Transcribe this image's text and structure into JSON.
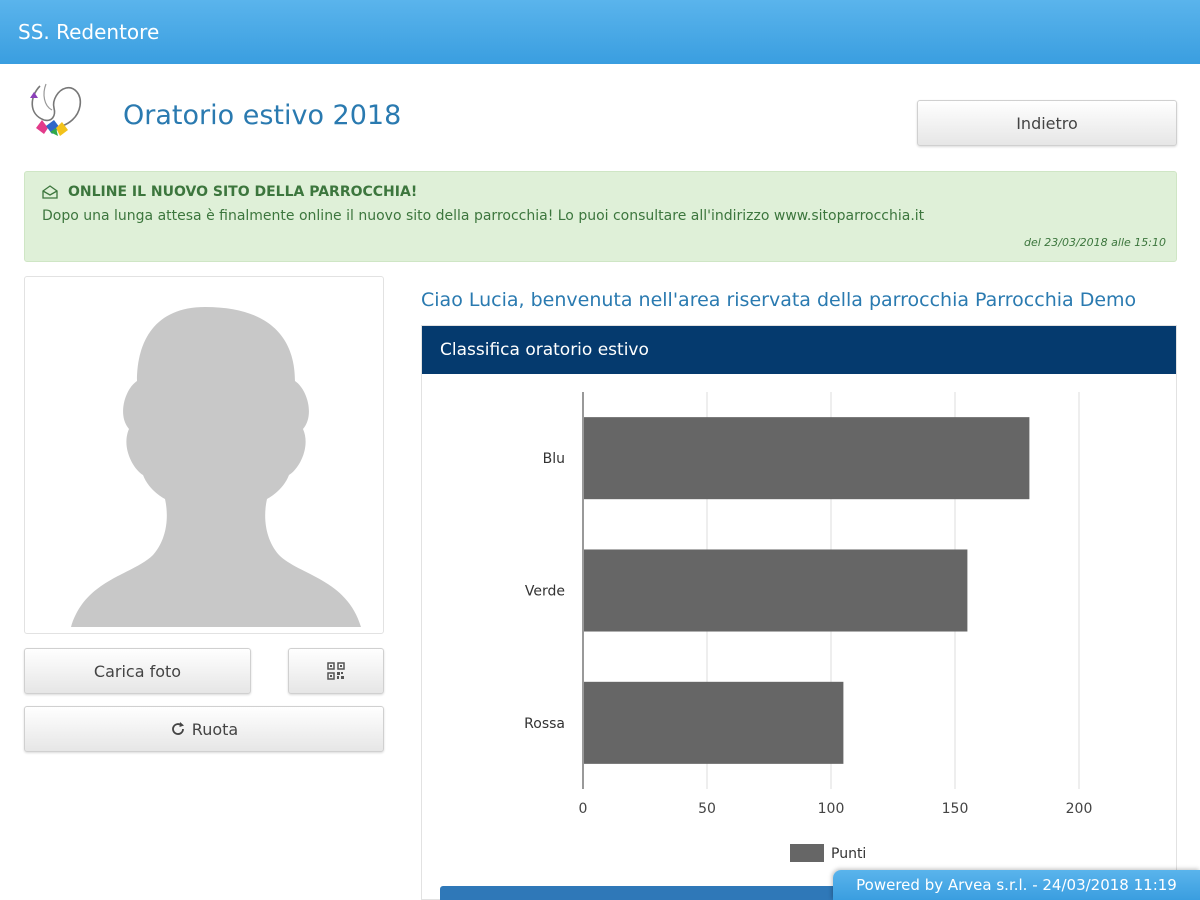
{
  "topbar": {
    "title": "SS. Redentore"
  },
  "header": {
    "page_title": "Oratorio estivo 2018",
    "back_label": "Indietro"
  },
  "alert": {
    "title": "ONLINE IL NUOVO SITO DELLA PARROCCHIA!",
    "body": "Dopo una lunga attesa è finalmente online il nuovo sito della parrocchia! Lo puoi consultare all'indirizzo www.sitoparrocchia.it",
    "date": "del 23/03/2018 alle 15:10"
  },
  "profile": {
    "upload_label": "Carica foto",
    "qr_icon": "qr-code-icon",
    "rotate_label": "Ruota"
  },
  "welcome": "Ciao Lucia, benvenuta nell'area riservata della parrocchia Parrocchia Demo",
  "panel": {
    "title": "Classifica oratorio estivo"
  },
  "chart_data": {
    "type": "bar",
    "orientation": "horizontal",
    "categories": [
      "Blu",
      "Verde",
      "Rossa"
    ],
    "series": [
      {
        "name": "Punti",
        "values": [
          180,
          155,
          105
        ],
        "color": "#666666"
      }
    ],
    "xlim": [
      0,
      200
    ],
    "xticks": [
      0,
      50,
      100,
      150,
      200
    ],
    "grid": true,
    "legend": "bottom"
  },
  "footer": {
    "text": "Powered by Arvea s.r.l. - 24/03/2018 11:19"
  },
  "colors": {
    "topbar": "#3a9ee0",
    "panel_header": "#053a6e",
    "title_text": "#2a7ab0",
    "alert_bg": "#dff0d8"
  }
}
